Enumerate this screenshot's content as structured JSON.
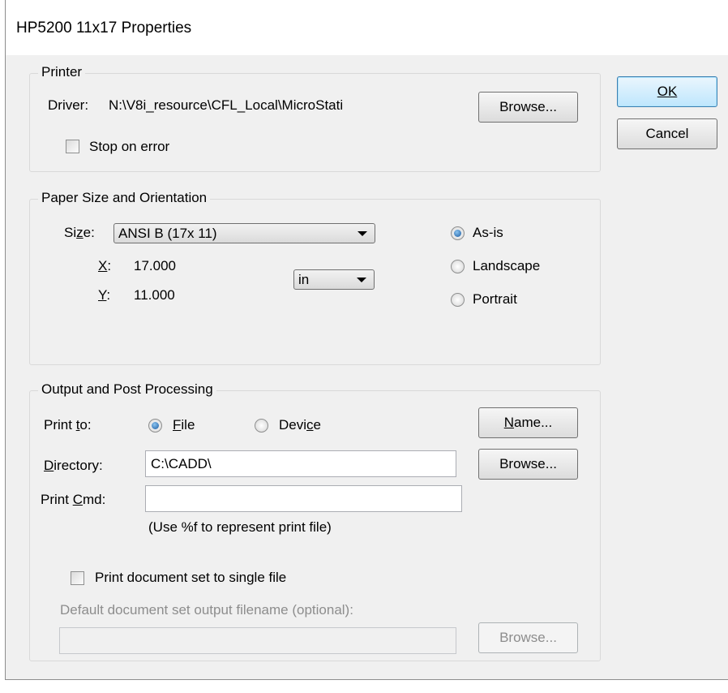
{
  "window": {
    "title": "HP5200 11x17 Properties"
  },
  "buttons": {
    "ok": "OK",
    "cancel": "Cancel"
  },
  "printer": {
    "legend": "Printer",
    "driver_label": "Driver:",
    "driver_value": "N:\\V8i_resource\\CFL_Local\\MicroStati",
    "browse": "Browse...",
    "stop_on_error": "Stop on error"
  },
  "paper": {
    "legend": "Paper Size and Orientation",
    "size_label_pre": "Si",
    "size_label_key": "z",
    "size_label_post": "e:",
    "size_value": "ANSI B (17x 11)",
    "x_key": "X",
    "x_rest": ":",
    "x_value": "17.000",
    "y_key": "Y",
    "y_rest": ":",
    "y_value": "11.000",
    "units_value": "in",
    "orientation": {
      "as_is": "As-is",
      "landscape": "Landscape",
      "portrait": "Portrait",
      "selected": "as_is"
    }
  },
  "output": {
    "legend": "Output and Post Processing",
    "print_to_pre": "Print ",
    "print_to_key": "t",
    "print_to_post": "o:",
    "file_key": "F",
    "file_rest": "ile",
    "device_pre": "Devi",
    "device_key": "c",
    "device_post": "e",
    "name_key": "N",
    "name_rest": "ame...",
    "directory_key": "D",
    "directory_rest": "irectory:",
    "directory_value": "C:\\CADD\\",
    "browse": "Browse...",
    "print_cmd_pre": "Print ",
    "print_cmd_key": "C",
    "print_cmd_post": "md:",
    "print_cmd_value": "",
    "print_cmd_hint": "(Use %f to represent print file)",
    "single_file_label": "Print document set to single file",
    "default_filename_label": "Default document set output filename (optional):",
    "default_filename_value": "",
    "browse_disabled": "Browse..."
  }
}
